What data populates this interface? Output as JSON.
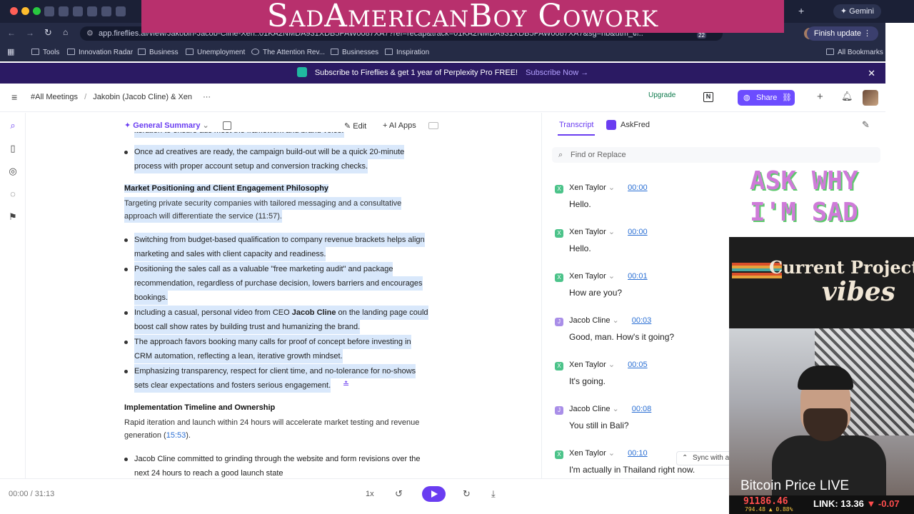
{
  "overlay": {
    "title": "SadAmericanBoy Cowork",
    "ask_line1": "ASK WHY",
    "ask_line2": "I'M SAD",
    "vibes_line1": "Current Project",
    "vibes_line2": "vibes",
    "btc_title": "Bitcoin Price LIVE",
    "btc_price": "91186.46",
    "btc_sub": "794.48 ▲ 0.88%",
    "btc_link": "LINK: 13.36",
    "btc_link_change": "▼ -0.07"
  },
  "browser": {
    "gemini": "Gemini",
    "url": "app.fireflies.ai/view/Jakobin-Jacob-Cline-Xen::01KA2NMDA931XDB5PAW0087XA7?ref=recap&track=01KA2NMDA931XDB5PAW0087XA7&sg=nb&utm_c...",
    "finish_update": "Finish update",
    "bookmarks": [
      "Tools",
      "Innovation Radar",
      "Business",
      "Unemployment",
      "The Attention Rev...",
      "Businesses",
      "Inspiration"
    ],
    "all_bookmarks": "All Bookmarks",
    "tab_badge": "22"
  },
  "promo": {
    "text": "Subscribe to Fireflies & get 1 year of Perplexity Pro FREE!",
    "link": "Subscribe Now →"
  },
  "header": {
    "crumb1": "#All Meetings",
    "crumb_sep": "/",
    "crumb2": "Jakobin (Jacob Cline) & Xen",
    "more": "···",
    "upgrade": "Upgrade",
    "share": "Share"
  },
  "toolbar": {
    "general_summary": "General Summary",
    "edit": "Edit",
    "ai_apps": "AI Apps"
  },
  "summary": {
    "top_cutoff": "iteration to ensure ads meet the framework and brand voice.",
    "bullet0_l1": "Once ad creatives are ready, the campaign build-out will be a quick 20-minute",
    "bullet0_l2": "process with proper account setup and conversion tracking checks.",
    "section1_title": "Market Positioning and Client Engagement Philosophy",
    "section1_p_l1": "Targeting private security companies with tailored messaging and a consultative",
    "section1_p_l2": "approach will differentiate the service (11:57).",
    "b1_l1": "Switching from budget-based qualification to company revenue brackets helps align",
    "b1_l2": "marketing and sales with client capacity and readiness.",
    "b2_l1": "Positioning the sales call as a valuable \"free marketing audit\" and package",
    "b2_l2": "recommendation, regardless of purchase decision, lowers barriers and encourages",
    "b2_l3": "bookings.",
    "b3_l1a": "Including a casual, personal video from CEO ",
    "b3_l1b": "Jacob Cline",
    "b3_l1c": " on the landing page could",
    "b3_l2": "boost call show rates by building trust and humanizing the brand.",
    "b4_l1": "The approach favors booking many calls for proof of concept before investing in",
    "b4_l2": "CRM automation, reflecting a lean, iterative growth mindset.",
    "b5_l1": "Emphasizing transparency, respect for client time, and no-tolerance for no-shows",
    "b5_l2": "sets clear expectations and fosters serious engagement.",
    "section2_title": "Implementation Timeline and Ownership",
    "section2_p_l1": "Rapid iteration and launch within 24 hours will accelerate market testing and revenue",
    "section2_p_l2a": "generation (",
    "section2_p_l2b": "15:53",
    "section2_p_l2c": ").",
    "b6_l1a": "Jacob Cline",
    "b6_l1b": " committed to grinding through the website and form revisions over the",
    "b6_l2": "next 24 hours to reach a good launch state"
  },
  "transcript": {
    "tab_transcript": "Transcript",
    "tab_askfred": "AskFred",
    "find_placeholder": "Find or Replace",
    "sync": "Sync with au",
    "entries": [
      {
        "speaker": "Xen Taylor",
        "initial": "X",
        "time": "00:00",
        "text": "Hello."
      },
      {
        "speaker": "Xen Taylor",
        "initial": "X",
        "time": "00:00",
        "text": "Hello."
      },
      {
        "speaker": "Xen Taylor",
        "initial": "X",
        "time": "00:01",
        "text": "How are you?"
      },
      {
        "speaker": "Jacob Cline",
        "initial": "J",
        "time": "00:03",
        "text": "Good, man. How's it going?"
      },
      {
        "speaker": "Xen Taylor",
        "initial": "X",
        "time": "00:05",
        "text": "It's going."
      },
      {
        "speaker": "Jacob Cline",
        "initial": "J",
        "time": "00:08",
        "text": "You still in Bali?"
      },
      {
        "speaker": "Xen Taylor",
        "initial": "X",
        "time": "00:10",
        "text": "I'm actually in Thailand right now."
      }
    ]
  },
  "player": {
    "current": "00:00",
    "sep": " / ",
    "total": "31:13",
    "speed": "1x"
  },
  "colors": {
    "accent": "#6a3df1",
    "highlight": "#d9e8fb",
    "xen_badge": "#4cc38a",
    "jacob_badge": "#a98ee8"
  }
}
